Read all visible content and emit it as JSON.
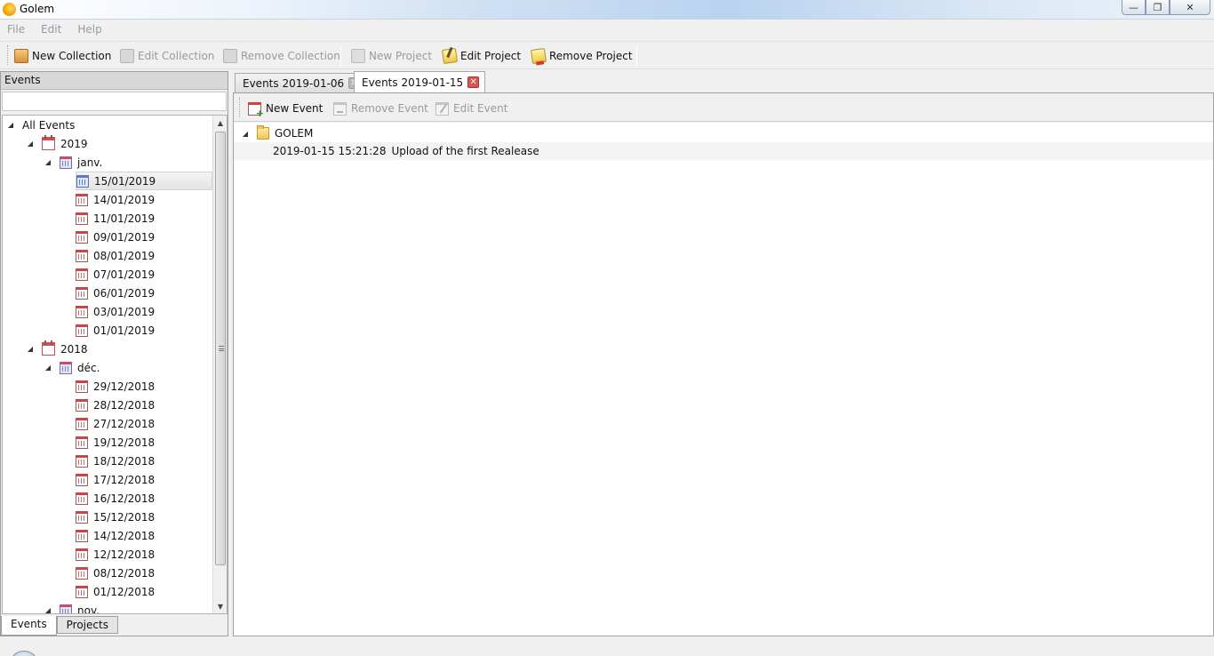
{
  "window": {
    "title": "Golem"
  },
  "menu": {
    "items": [
      "File",
      "Edit",
      "Help"
    ]
  },
  "toolbar": {
    "new_collection": "New Collection",
    "edit_collection": "Edit Collection",
    "remove_collection": "Remove Collection",
    "new_project": "New Project",
    "edit_project": "Edit Project",
    "remove_project": "Remove Project"
  },
  "left_panel": {
    "header": "Events",
    "search_value": "",
    "tree": {
      "root": "All Events",
      "years": [
        {
          "label": "2019",
          "months": [
            {
              "label": "janv.",
              "days": [
                "15/01/2019",
                "14/01/2019",
                "11/01/2019",
                "09/01/2019",
                "08/01/2019",
                "07/01/2019",
                "06/01/2019",
                "03/01/2019",
                "01/01/2019"
              ]
            }
          ]
        },
        {
          "label": "2018",
          "months": [
            {
              "label": "déc.",
              "days": [
                "29/12/2018",
                "28/12/2018",
                "27/12/2018",
                "19/12/2018",
                "18/12/2018",
                "17/12/2018",
                "16/12/2018",
                "15/12/2018",
                "14/12/2018",
                "12/12/2018",
                "08/12/2018",
                "01/12/2018"
              ]
            },
            {
              "label": "nov.",
              "days": []
            }
          ]
        }
      ],
      "selected_day": "15/01/2019"
    },
    "tabs": [
      "Events",
      "Projects"
    ],
    "active_tab": "Events"
  },
  "doc_tabs": [
    {
      "label": "Events 2019-01-06",
      "active": false
    },
    {
      "label": "Events 2019-01-15",
      "active": true
    }
  ],
  "event_toolbar": {
    "new_event": "New Event",
    "remove_event": "Remove Event",
    "edit_event": "Edit Event"
  },
  "events_view": {
    "group": "GOLEM",
    "entries": [
      {
        "timestamp": "2019-01-15 15:21:28",
        "text": "Upload of the first Realease"
      }
    ]
  },
  "colors": {
    "accent_red": "#d9534f",
    "disabled_text": "#9a9a9a",
    "panel_bg": "#f0f0f0"
  }
}
